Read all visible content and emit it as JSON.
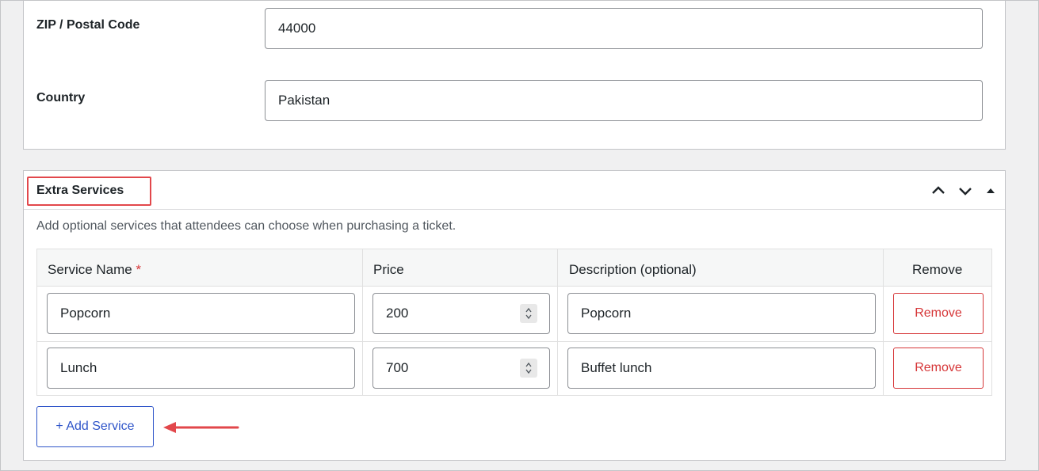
{
  "address": {
    "zip_label": "ZIP / Postal Code",
    "zip_value": "44000",
    "country_label": "Country",
    "country_value": "Pakistan"
  },
  "extra_services": {
    "title": "Extra Services",
    "description": "Add optional services that attendees can choose when purchasing a ticket.",
    "columns": {
      "service_name": "Service Name",
      "required_marker": "*",
      "price": "Price",
      "description": "Description (optional)",
      "remove": "Remove"
    },
    "rows": [
      {
        "name": "Popcorn",
        "price": "200",
        "description": "Popcorn",
        "remove_label": "Remove"
      },
      {
        "name": "Lunch",
        "price": "700",
        "description": "Buffet lunch",
        "remove_label": "Remove"
      }
    ],
    "add_button": "+ Add Service"
  },
  "colors": {
    "highlight": "#e2474b",
    "remove": "#d63638",
    "add": "#2f55c9"
  },
  "icons": [
    "chevron-up-icon",
    "chevron-down-icon",
    "caret-up-icon",
    "spinner-icon",
    "red-arrow-icon"
  ]
}
